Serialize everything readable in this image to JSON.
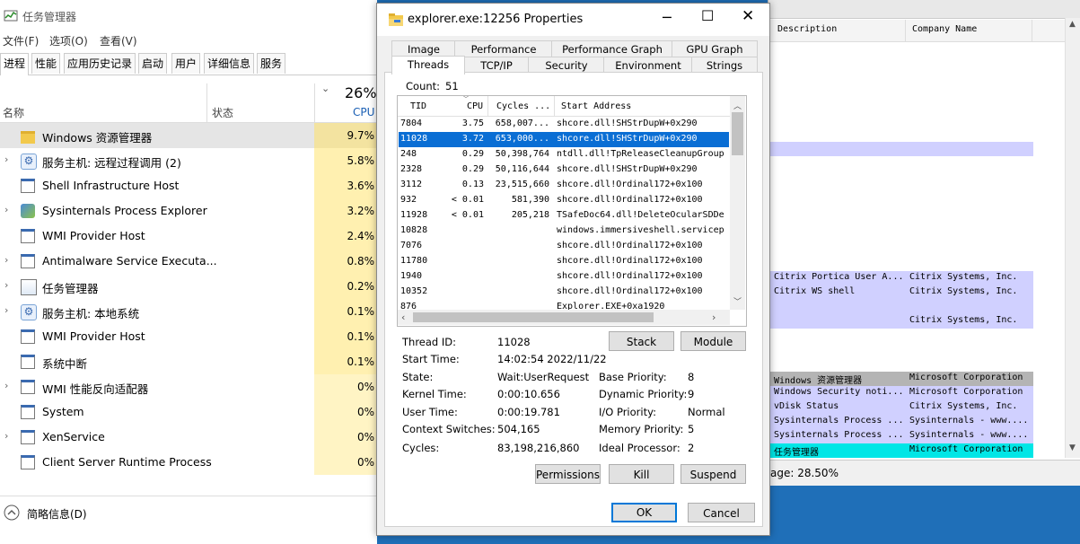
{
  "taskmgr": {
    "title": "任务管理器",
    "menu": [
      "文件(F)",
      "选项(O)",
      "查看(V)"
    ],
    "tabs": [
      "进程",
      "性能",
      "应用历史记录",
      "启动",
      "用户",
      "详细信息",
      "服务"
    ],
    "active_tab": "进程",
    "col_name": "名称",
    "col_status": "状态",
    "cpu_total": "26%",
    "cpu_label": "CPU",
    "rows": [
      {
        "name": "Windows 资源管理器",
        "cpu": "9.7%",
        "icon": "folder-icon",
        "expand": false
      },
      {
        "name": "服务主机: 远程过程调用 (2)",
        "cpu": "5.8%",
        "icon": "gear-icon",
        "expand": true
      },
      {
        "name": "Shell Infrastructure Host",
        "cpu": "3.6%",
        "icon": "app-window-icon",
        "expand": false
      },
      {
        "name": "Sysinternals Process Explorer",
        "cpu": "3.2%",
        "icon": "process-explorer-icon",
        "expand": true
      },
      {
        "name": "WMI Provider Host",
        "cpu": "2.4%",
        "icon": "app-window-icon",
        "expand": false
      },
      {
        "name": "Antimalware Service Executa...",
        "cpu": "0.8%",
        "icon": "app-window-icon",
        "expand": true
      },
      {
        "name": "任务管理器",
        "cpu": "0.2%",
        "icon": "taskmgr-icon",
        "expand": true
      },
      {
        "name": "服务主机: 本地系统",
        "cpu": "0.1%",
        "icon": "gear-icon",
        "expand": true
      },
      {
        "name": "WMI Provider Host",
        "cpu": "0.1%",
        "icon": "app-window-icon",
        "expand": false
      },
      {
        "name": "系统中断",
        "cpu": "0.1%",
        "icon": "app-window-icon",
        "expand": false
      },
      {
        "name": "WMI 性能反向适配器",
        "cpu": "0%",
        "icon": "app-window-icon",
        "expand": true
      },
      {
        "name": "System",
        "cpu": "0%",
        "icon": "app-window-icon",
        "expand": false
      },
      {
        "name": "XenService",
        "cpu": "0%",
        "icon": "app-window-icon",
        "expand": true
      },
      {
        "name": "Client Server Runtime Process",
        "cpu": "0%",
        "icon": "app-window-icon",
        "expand": false
      }
    ],
    "footer": "简略信息(D)"
  },
  "procexp": {
    "col_description": "Description",
    "col_company": "Company Name",
    "rows": [
      {
        "desc": "Citrix Portica User A...",
        "company": "Citrix Systems, Inc.",
        "color": "#d0d0ff"
      },
      {
        "desc": "Citrix WS shell",
        "company": "Citrix Systems, Inc.",
        "color": "#d0d0ff"
      },
      {
        "desc": "",
        "company": "",
        "color": "#d0d0ff"
      },
      {
        "desc": "",
        "company": "Citrix Systems, Inc.",
        "color": "#d0d0ff"
      },
      {
        "desc": "Windows 资源管理器",
        "company": "Microsoft Corporation",
        "color": "#b4b4b4"
      },
      {
        "desc": "Windows Security noti...",
        "company": "Microsoft Corporation",
        "color": "#d0d0ff"
      },
      {
        "desc": "vDisk Status",
        "company": "Citrix Systems, Inc.",
        "color": "#d0d0ff"
      },
      {
        "desc": "Sysinternals Process ...",
        "company": "Sysinternals - www....",
        "color": "#d0d0ff"
      },
      {
        "desc": "Sysinternals Process ...",
        "company": "Sysinternals - www....",
        "color": "#d0d0ff"
      },
      {
        "desc": "任务管理器",
        "company": "Microsoft Corporation",
        "color": "#00e6e6"
      }
    ],
    "status": "age: 28.50%"
  },
  "dialog": {
    "title": "explorer.exe:12256 Properties",
    "tabs_row1": [
      "Image",
      "Performance",
      "Performance Graph",
      "GPU Graph"
    ],
    "tabs_row2": [
      "Threads",
      "TCP/IP",
      "Security",
      "Environment",
      "Strings"
    ],
    "active_tab": "Threads",
    "count_label": "Count:",
    "count_value": "51",
    "columns": [
      "TID",
      "CPU",
      "Cycles ...",
      "Start Address"
    ],
    "threads": [
      {
        "tid": "7804",
        "cpu": "3.75",
        "cycles": "658,007...",
        "addr": "shcore.dll!SHStrDupW+0x290",
        "selected": false
      },
      {
        "tid": "11028",
        "cpu": "3.72",
        "cycles": "653,000...",
        "addr": "shcore.dll!SHStrDupW+0x290",
        "selected": true
      },
      {
        "tid": "248",
        "cpu": "0.29",
        "cycles": "50,398,764",
        "addr": "ntdll.dll!TpReleaseCleanupGroup",
        "selected": false
      },
      {
        "tid": "2328",
        "cpu": "0.29",
        "cycles": "50,116,644",
        "addr": "shcore.dll!SHStrDupW+0x290",
        "selected": false
      },
      {
        "tid": "3112",
        "cpu": "0.13",
        "cycles": "23,515,660",
        "addr": "shcore.dll!Ordinal172+0x100",
        "selected": false
      },
      {
        "tid": "932",
        "cpu": "< 0.01",
        "cycles": "581,390",
        "addr": "shcore.dll!Ordinal172+0x100",
        "selected": false
      },
      {
        "tid": "11928",
        "cpu": "< 0.01",
        "cycles": "205,218",
        "addr": "TSafeDoc64.dll!DeleteOcularSDDe",
        "selected": false
      },
      {
        "tid": "10828",
        "cpu": "",
        "cycles": "",
        "addr": "windows.immersiveshell.servicep",
        "selected": false
      },
      {
        "tid": "7076",
        "cpu": "",
        "cycles": "",
        "addr": "shcore.dll!Ordinal172+0x100",
        "selected": false
      },
      {
        "tid": "11780",
        "cpu": "",
        "cycles": "",
        "addr": "shcore.dll!Ordinal172+0x100",
        "selected": false
      },
      {
        "tid": "1940",
        "cpu": "",
        "cycles": "",
        "addr": "shcore.dll!Ordinal172+0x100",
        "selected": false
      },
      {
        "tid": "10352",
        "cpu": "",
        "cycles": "",
        "addr": "shcore.dll!Ordinal172+0x100",
        "selected": false
      },
      {
        "tid": "876",
        "cpu": "",
        "cycles": "",
        "addr": "Explorer.EXE+0xa1920",
        "selected": false
      }
    ],
    "details": {
      "thread_id_label": "Thread ID:",
      "thread_id": "11028",
      "start_time_label": "Start Time:",
      "start_time": "14:02:54  2022/11/22",
      "state_label": "State:",
      "state": "Wait:UserRequest",
      "kernel_label": "Kernel Time:",
      "kernel": "0:00:10.656",
      "user_label": "User Time:",
      "user": "0:00:19.781",
      "ctx_label": "Context Switches:",
      "ctx": "504,165",
      "cycles_label": "Cycles:",
      "cycles": "83,198,216,860",
      "base_prio_label": "Base Priority:",
      "base_prio": "8",
      "dyn_prio_label": "Dynamic Priority:",
      "dyn_prio": "9",
      "io_prio_label": "I/O Priority:",
      "io_prio": "Normal",
      "mem_prio_label": "Memory Priority:",
      "mem_prio": "5",
      "ideal_label": "Ideal Processor:",
      "ideal": "2"
    },
    "buttons": {
      "stack": "Stack",
      "module": "Module",
      "permissions": "Permissions",
      "kill": "Kill",
      "suspend": "Suspend",
      "ok": "OK",
      "cancel": "Cancel"
    }
  }
}
